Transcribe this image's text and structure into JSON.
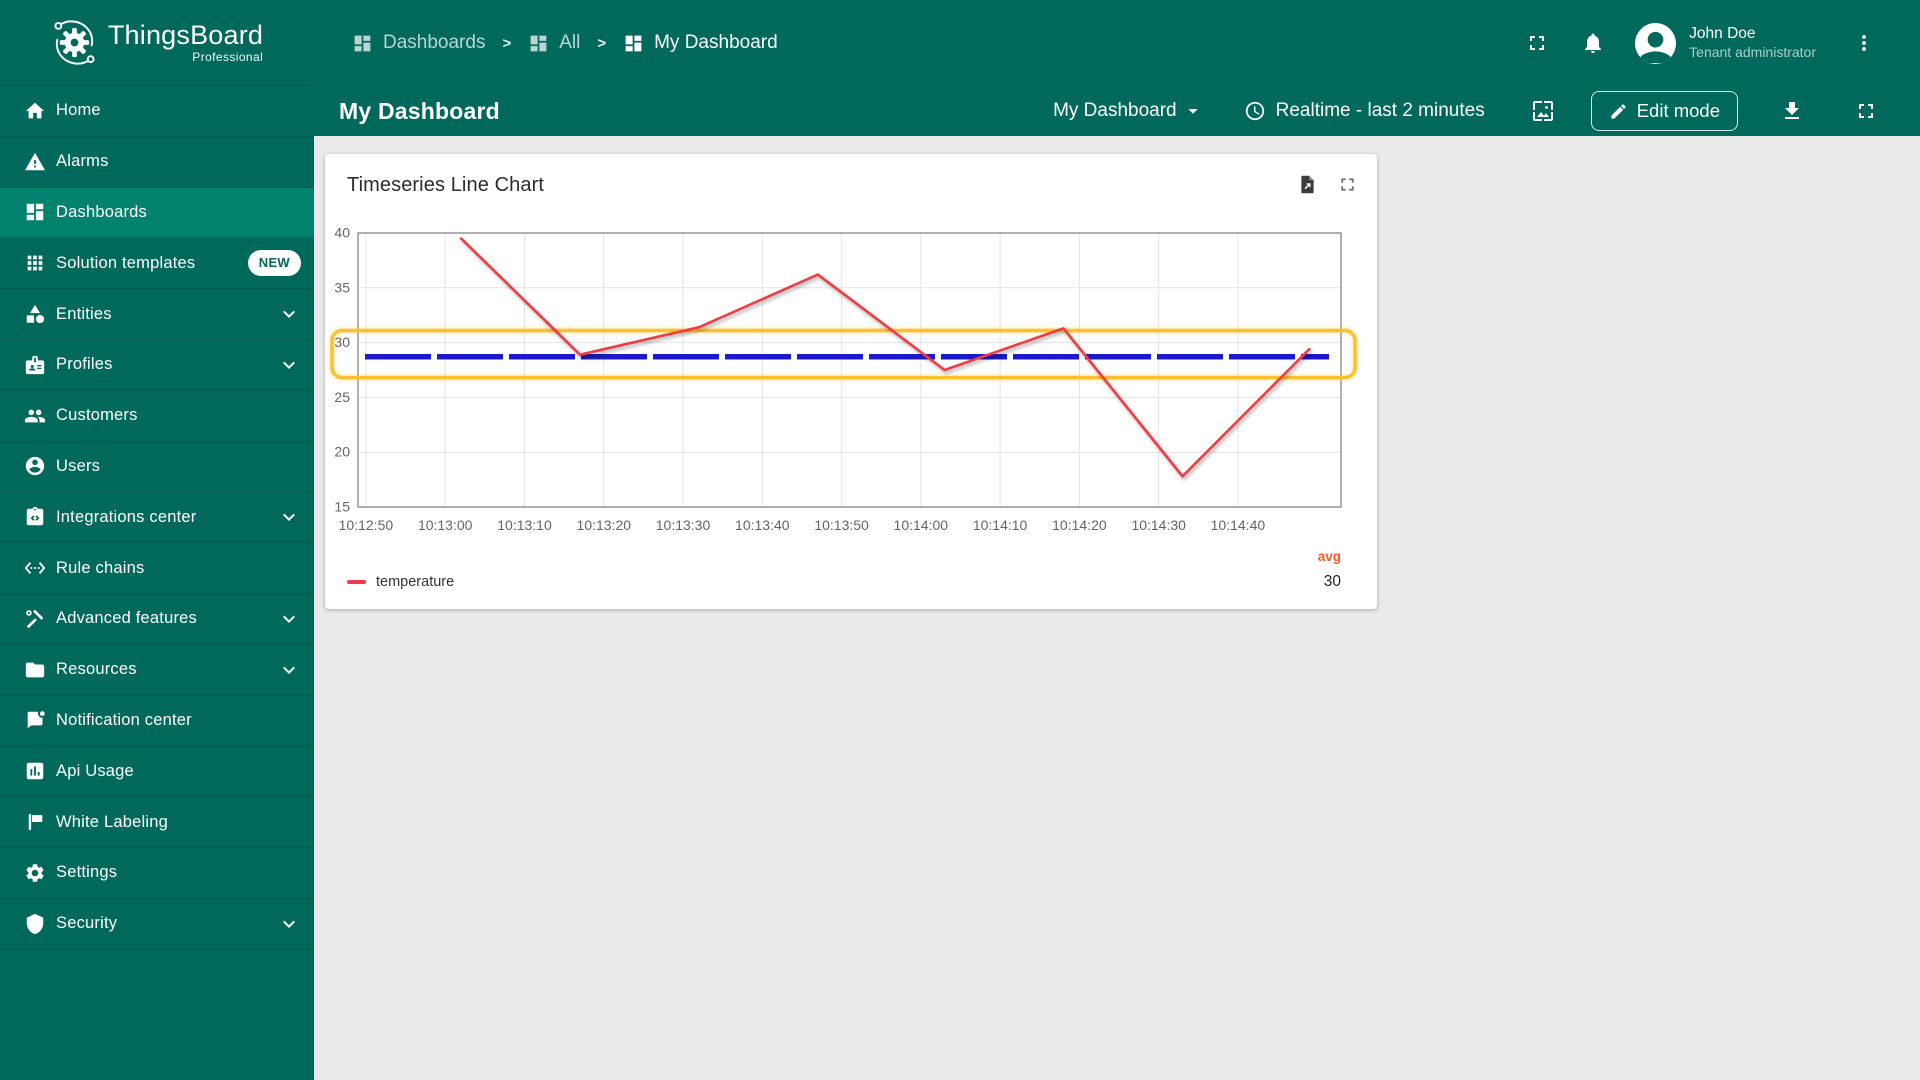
{
  "app": {
    "brand": "ThingsBoard",
    "brand_sub": "Professional"
  },
  "colors": {
    "sidebar_bg": "#00695c",
    "sidebar_active_bg": "#00826f",
    "main_bg": "#eaeaea",
    "series_red": "#f23a42",
    "threshold_blue": "#1a1ac6",
    "band_amber": "#ffc02e",
    "avg_orange": "#ff5722"
  },
  "sidebar": {
    "items": [
      {
        "id": "home",
        "label": "Home",
        "icon": "home",
        "active": false,
        "badge": "",
        "expandable": false
      },
      {
        "id": "alarms",
        "label": "Alarms",
        "icon": "alarms",
        "active": false,
        "badge": "",
        "expandable": false
      },
      {
        "id": "dashboards",
        "label": "Dashboards",
        "icon": "dashboards",
        "active": true,
        "badge": "",
        "expandable": false
      },
      {
        "id": "solution-templates",
        "label": "Solution templates",
        "icon": "grid",
        "active": false,
        "badge": "NEW",
        "expandable": false
      },
      {
        "id": "entities",
        "label": "Entities",
        "icon": "entities",
        "active": false,
        "badge": "",
        "expandable": true
      },
      {
        "id": "profiles",
        "label": "Profiles",
        "icon": "profiles",
        "active": false,
        "badge": "",
        "expandable": true
      },
      {
        "id": "customers",
        "label": "Customers",
        "icon": "customers",
        "active": false,
        "badge": "",
        "expandable": false
      },
      {
        "id": "users",
        "label": "Users",
        "icon": "users",
        "active": false,
        "badge": "",
        "expandable": false
      },
      {
        "id": "integrations-center",
        "label": "Integrations center",
        "icon": "integrations",
        "active": false,
        "badge": "",
        "expandable": true
      },
      {
        "id": "rule-chains",
        "label": "Rule chains",
        "icon": "rule-chains",
        "active": false,
        "badge": "",
        "expandable": false
      },
      {
        "id": "advanced-features",
        "label": "Advanced features",
        "icon": "advanced",
        "active": false,
        "badge": "",
        "expandable": true
      },
      {
        "id": "resources",
        "label": "Resources",
        "icon": "resources",
        "active": false,
        "badge": "",
        "expandable": true
      },
      {
        "id": "notification-center",
        "label": "Notification center",
        "icon": "notifications",
        "active": false,
        "badge": "",
        "expandable": false
      },
      {
        "id": "api-usage",
        "label": "Api Usage",
        "icon": "api-usage",
        "active": false,
        "badge": "",
        "expandable": false
      },
      {
        "id": "white-labeling",
        "label": "White Labeling",
        "icon": "white-labeling",
        "active": false,
        "badge": "",
        "expandable": false
      },
      {
        "id": "settings",
        "label": "Settings",
        "icon": "settings",
        "active": false,
        "badge": "",
        "expandable": false
      },
      {
        "id": "security",
        "label": "Security",
        "icon": "security",
        "active": false,
        "badge": "",
        "expandable": true
      }
    ]
  },
  "header": {
    "breadcrumb": [
      {
        "label": "Dashboards",
        "icon": "dashboards",
        "dim": true
      },
      {
        "label": "All",
        "icon": "dashboards",
        "dim": true
      },
      {
        "label": "My Dashboard",
        "icon": "dashboards",
        "dim": false
      }
    ],
    "user": {
      "name": "John Doe",
      "role": "Tenant administrator"
    }
  },
  "toolbar": {
    "title": "My Dashboard",
    "dashboard_select": "My Dashboard",
    "time_window": "Realtime - last 2 minutes",
    "edit_button": "Edit mode"
  },
  "widget": {
    "title": "Timeseries Line Chart"
  },
  "chart_data": {
    "type": "line",
    "title": "Timeseries Line Chart",
    "xlabel": "",
    "ylabel": "",
    "x_type": "time",
    "xlim": [
      "10:12:49",
      "10:14:53"
    ],
    "xticks": [
      "10:12:50",
      "10:13:00",
      "10:13:10",
      "10:13:20",
      "10:13:30",
      "10:13:40",
      "10:13:50",
      "10:14:00",
      "10:14:10",
      "10:14:20",
      "10:14:30",
      "10:14:40"
    ],
    "ylim": [
      15,
      40
    ],
    "yticks": [
      15,
      20,
      25,
      30,
      35,
      40
    ],
    "grid": true,
    "series": [
      {
        "name": "temperature",
        "color": "#f23a42",
        "points": [
          [
            "10:13:02",
            39.5
          ],
          [
            "10:13:17",
            28.9
          ],
          [
            "10:13:32",
            31.4
          ],
          [
            "10:13:47",
            36.2
          ],
          [
            "10:14:03",
            27.5
          ],
          [
            "10:14:18",
            31.3
          ],
          [
            "10:14:33",
            17.8
          ],
          [
            "10:14:49",
            29.4
          ]
        ]
      }
    ],
    "threshold_line": {
      "value": 28.7,
      "color": "#1a1ac6",
      "style": "dashed"
    },
    "highlight_band": {
      "from": 26.8,
      "to": 31.1,
      "color": "#ffc02e"
    },
    "legend": {
      "position": "bottom",
      "series_label": "temperature",
      "agg_header": "avg",
      "agg_value": "30",
      "agg_header_color": "#ff5722"
    }
  }
}
